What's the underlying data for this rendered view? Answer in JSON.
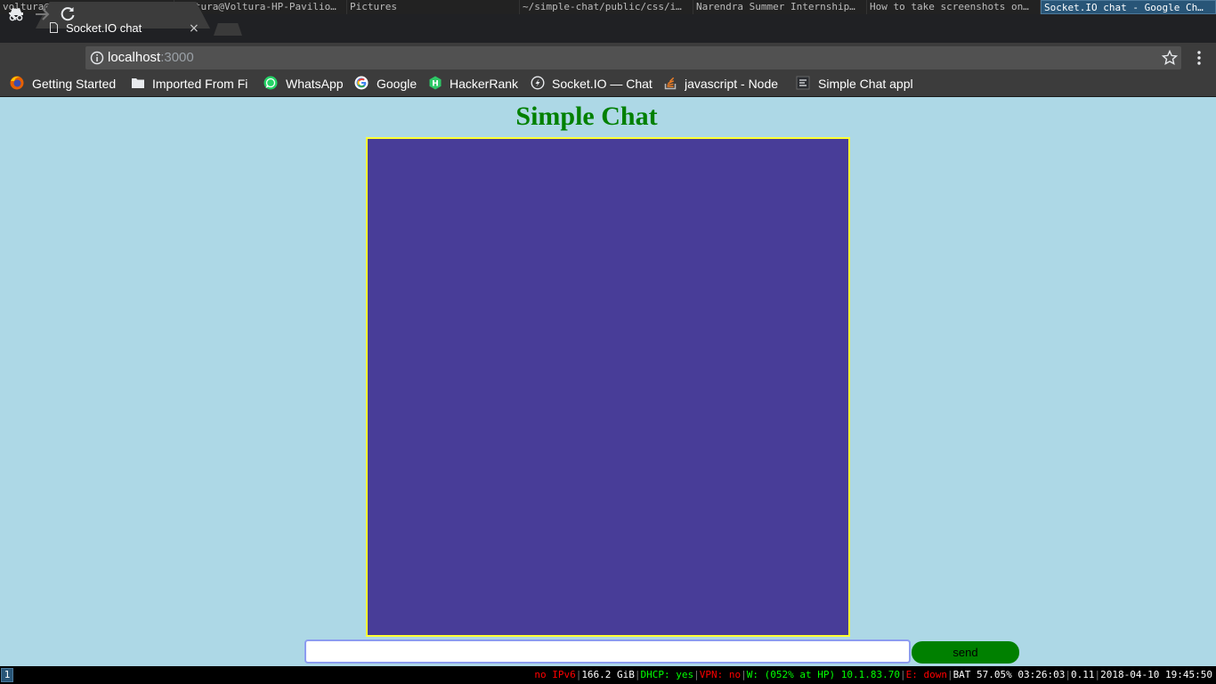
{
  "wm": {
    "windows": [
      {
        "title": "voltura@Voltura-HP-Pavilio…",
        "width": 196
      },
      {
        "title": "voltura@Voltura-HP-Pavilio…",
        "width": 194
      },
      {
        "title": "Pictures",
        "width": 194
      },
      {
        "title": "~/simple-chat/public/css/i…",
        "width": 195
      },
      {
        "title": "Narendra Summer Internship…",
        "width": 195
      },
      {
        "title": "How to take screenshots on…",
        "width": 195
      },
      {
        "title": "Socket.IO chat - Google Ch…",
        "width": 197,
        "active": true
      }
    ],
    "workspace": "1",
    "status": {
      "ipv6": "no IPv6",
      "disk": "166.2 GiB",
      "dhcp": "DHCP: yes",
      "vpn": "VPN: no",
      "wifi": "W: (052% at HP) 10.1.83.70",
      "eth": "E: down",
      "battery": "BAT 57.05% 03:26:03",
      "load": "0.11",
      "datetime": "2018-04-10 19:45:50",
      "colors": {
        "bad": "#ff0000",
        "good": "#00ff00",
        "neutral": "#ffffff"
      }
    }
  },
  "browser": {
    "tab": {
      "title": "Socket.IO chat",
      "close": "×"
    },
    "url": {
      "host": "localhost",
      "port": ":3000"
    },
    "bookmarks": [
      {
        "label": "Getting Started",
        "icon": "firefox-icon"
      },
      {
        "label": "Imported From Fi",
        "icon": "folder-icon"
      },
      {
        "label": "WhatsApp",
        "icon": "whatsapp-icon"
      },
      {
        "label": "Google",
        "icon": "google-icon"
      },
      {
        "label": "HackerRank",
        "icon": "hackerrank-icon"
      },
      {
        "label": "Socket.IO — Chat",
        "icon": "socketio-icon"
      },
      {
        "label": "javascript - Node",
        "icon": "stackoverflow-icon"
      },
      {
        "label": "Simple Chat appl",
        "icon": "page-icon"
      }
    ]
  },
  "page": {
    "title": "Simple Chat",
    "send_label": "send",
    "input_value": "",
    "colors": {
      "background": "#add8e6",
      "title": "#008000",
      "chat_box": "#483d98",
      "chat_border": "#ffff33",
      "send_button": "#008000"
    }
  }
}
